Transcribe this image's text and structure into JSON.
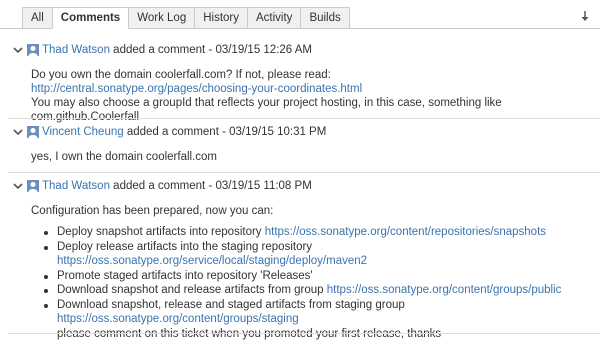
{
  "tabs": [
    {
      "label": "All"
    },
    {
      "label": "Comments"
    },
    {
      "label": "Work Log"
    },
    {
      "label": "History"
    },
    {
      "label": "Activity"
    },
    {
      "label": "Builds"
    }
  ],
  "active_tab": "Comments",
  "icons": {
    "sort": "sort-down-icon",
    "collapse": "chevron-down-icon",
    "avatar": "user-avatar-icon"
  },
  "colors": {
    "link": "#3b73af",
    "text": "#333333",
    "divider": "#dddddd"
  },
  "comments": [
    {
      "author": "Thad Watson",
      "action": "added a comment - 03/19/15 12:26 AM",
      "line1": "Do you own the domain coolerfall.com? If not, please read:",
      "link": "http://central.sonatype.org/pages/choosing-your-coordinates.html",
      "line2": "You may also choose a groupId that reflects your project hosting, in this case, something like com.github.Coolerfall"
    },
    {
      "author": "Vincent Cheung",
      "action": "added a comment - 03/19/15 10:31 PM",
      "line1": "yes, I own the domain coolerfall.com"
    },
    {
      "author": "Thad Watson",
      "action": "added a comment - 03/19/15 11:08 PM",
      "intro": "Configuration has been prepared, now you can:",
      "bullets": [
        {
          "text": "Deploy snapshot artifacts into repository ",
          "link": "https://oss.sonatype.org/content/repositories/snapshots"
        },
        {
          "text": "Deploy release artifacts into the staging repository ",
          "link": "https://oss.sonatype.org/service/local/staging/deploy/maven2"
        },
        {
          "text": "Promote staged artifacts into repository 'Releases'",
          "link": ""
        },
        {
          "text": "Download snapshot and release artifacts from group ",
          "link": "https://oss.sonatype.org/content/groups/public"
        },
        {
          "text": "Download snapshot, release and staged artifacts from staging group",
          "link": "https://oss.sonatype.org/content/groups/staging"
        }
      ],
      "closing": "please comment on this ticket when you promoted your first release, thanks"
    }
  ]
}
